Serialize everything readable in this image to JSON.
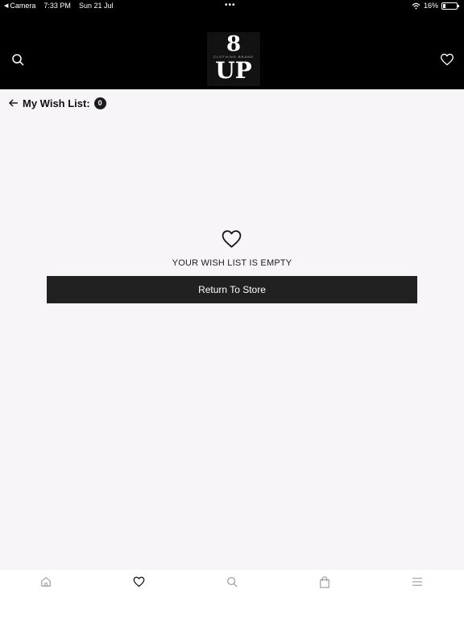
{
  "status_bar": {
    "back_app": "Camera",
    "time": "7:33 PM",
    "date": "Sun 21 Jul",
    "dots": "•••",
    "battery": "16%",
    "battery_level": 0.16
  },
  "header": {
    "logo": {
      "top": "8",
      "middle": "CLOTHING BRAND",
      "bottom": "UP"
    },
    "search_icon": "search-icon",
    "wishlist_icon": "heart-icon"
  },
  "page": {
    "title": "My Wish List:",
    "count": "0",
    "back_icon": "arrow-left-icon"
  },
  "empty_state": {
    "icon": "heart-icon",
    "message": "YOUR WISH LIST IS EMPTY",
    "button_label": "Return To Store"
  },
  "bottom_nav": {
    "items": [
      {
        "icon": "home-icon",
        "active": false
      },
      {
        "icon": "heart-icon",
        "active": true
      },
      {
        "icon": "search-icon",
        "active": false
      },
      {
        "icon": "bag-icon",
        "active": false
      },
      {
        "icon": "menu-icon",
        "active": false
      }
    ]
  },
  "colors": {
    "header_bg": "#000000",
    "page_bg": "#f7f5f8",
    "button_bg": "#212121",
    "nav_inactive": "#9a9a9a",
    "nav_active": "#111111"
  }
}
